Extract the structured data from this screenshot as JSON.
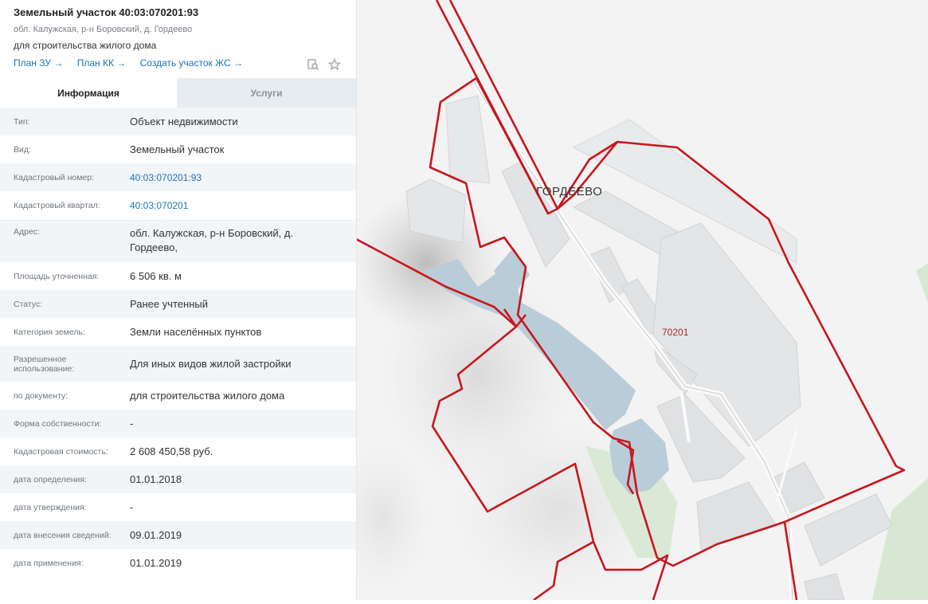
{
  "parcel": {
    "title": "Земельный участок 40:03:070201:93",
    "address": "обл. Калужская, р-н Боровский, д. Гордеево",
    "purpose": "для строительства жилого дома"
  },
  "links": [
    {
      "label": "План ЗУ →"
    },
    {
      "label": "План КК →"
    },
    {
      "label": "Создать участок ЖС →"
    }
  ],
  "icons": {
    "search_doc": "document-search-icon",
    "star": "star-icon"
  },
  "tabs": {
    "info": "Информация",
    "services": "Услуги"
  },
  "rows": [
    {
      "key": "Тип:",
      "value": "Объект недвижимости"
    },
    {
      "key": "Вид:",
      "value": "Земельный участок"
    },
    {
      "key": "Кадастровый номер:",
      "value": "40:03:070201:93"
    },
    {
      "key": "Кадастровый квартал:",
      "value": "40:03:070201"
    },
    {
      "key": "Адрес:",
      "value": "обл. Калужская, р-н Боровский, д. Гордеево,"
    },
    {
      "key": "Площадь уточненная:",
      "value": "6 506 кв. м"
    },
    {
      "key": "Статус:",
      "value": "Ранее учтенный"
    },
    {
      "key": "Категория земель:",
      "value": "Земли населённых пунктов"
    },
    {
      "key": "Разрешенное использование:",
      "value": "Для иных видов жилой застройки"
    },
    {
      "key": "по документу:",
      "value": "для строительства жилого дома"
    },
    {
      "key": "Форма собственности:",
      "value": "-"
    },
    {
      "key": "Кадастровая стоимость:",
      "value": "2 608 450,58 руб."
    },
    {
      "key": "дата определения:",
      "value": "01.01.2018"
    },
    {
      "key": "дата утверждения:",
      "value": "-"
    },
    {
      "key": "дата внесения сведений:",
      "value": "09.01.2019"
    },
    {
      "key": "дата применения:",
      "value": "01.01.2019"
    }
  ],
  "map": {
    "village_label": "ГОРДЕЕВО",
    "quarter_label": "70201",
    "colors": {
      "boundary": "#c8161d",
      "water": "#b9cdd8",
      "block": "#e4e6e8",
      "green": "#d7e7d3"
    }
  }
}
